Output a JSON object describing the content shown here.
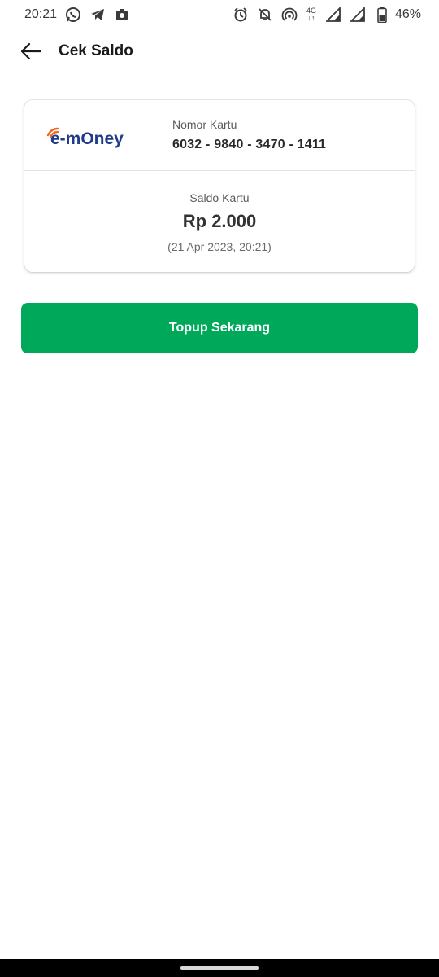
{
  "status_bar": {
    "time": "20:21",
    "battery": "46%",
    "network": "4G",
    "icons_left": [
      "whatsapp-icon",
      "telegram-icon",
      "camera-app-icon"
    ],
    "icons_right": [
      "alarm-icon",
      "notifications-off-icon",
      "hotspot-icon",
      "signal-icon",
      "signal-icon",
      "battery-icon"
    ]
  },
  "header": {
    "title": "Cek Saldo"
  },
  "card": {
    "brand": "e-mOney",
    "number_label": "Nomor Kartu",
    "number": "6032 - 9840 - 3470 - 1411",
    "balance_label": "Saldo Kartu",
    "balance": "Rp 2.000",
    "timestamp": "(21 Apr 2023, 20:21)"
  },
  "actions": {
    "topup_label": "Topup Sekarang"
  },
  "colors": {
    "primary_green": "#00a85a",
    "emoney_blue": "#1f3c88",
    "emoney_orange": "#f26522"
  }
}
